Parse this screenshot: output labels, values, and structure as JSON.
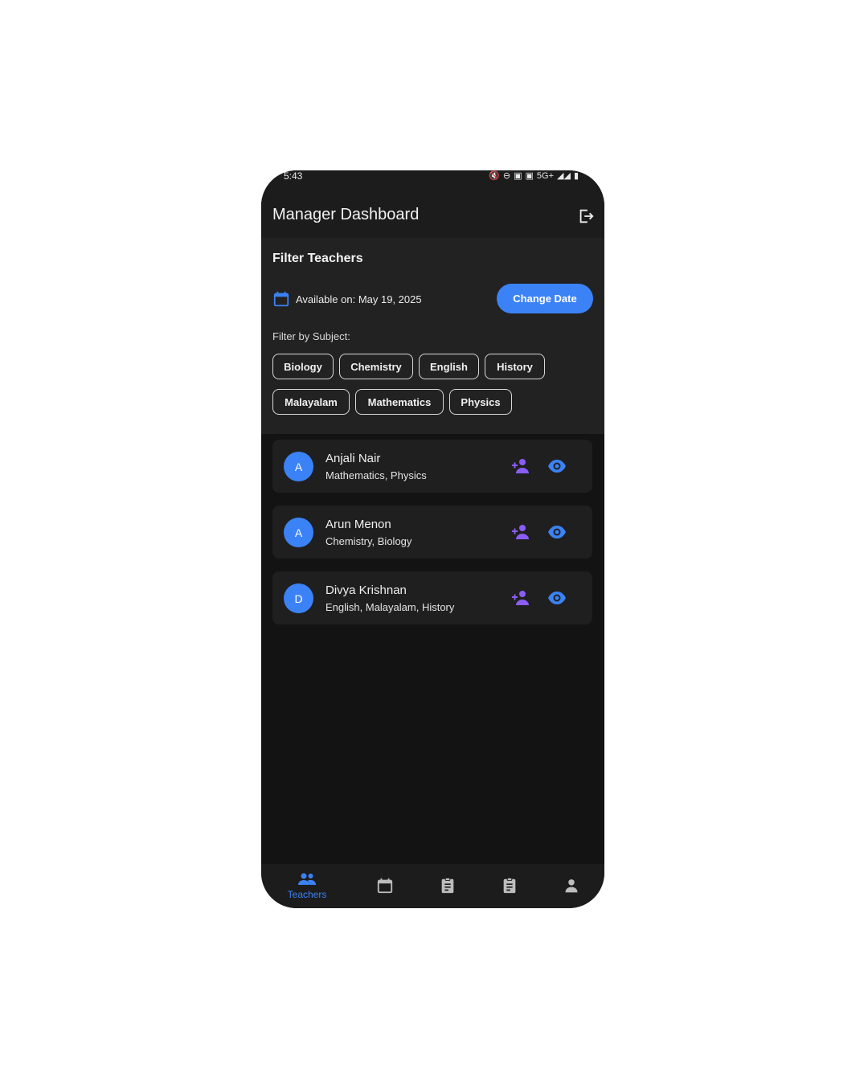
{
  "status_bar": {
    "time": "5:43",
    "network": "5G+"
  },
  "header": {
    "title": "Manager Dashboard"
  },
  "filter": {
    "heading": "Filter Teachers",
    "available_text": "Available on: May 19, 2025",
    "change_date_label": "Change Date",
    "subject_label": "Filter by Subject:",
    "subjects": [
      "Biology",
      "Chemistry",
      "English",
      "History",
      "Malayalam",
      "Mathematics",
      "Physics"
    ]
  },
  "teachers": [
    {
      "initial": "A",
      "name": "Anjali Nair",
      "subjects": "Mathematics, Physics"
    },
    {
      "initial": "A",
      "name": "Arun Menon",
      "subjects": "Chemistry, Biology"
    },
    {
      "initial": "D",
      "name": "Divya Krishnan",
      "subjects": "English, Malayalam, History"
    }
  ],
  "bottom_nav": {
    "items": [
      {
        "icon": "people-icon",
        "label": "Teachers",
        "active": true
      },
      {
        "icon": "calendar-icon",
        "label": ""
      },
      {
        "icon": "clipboard-icon",
        "label": ""
      },
      {
        "icon": "clipboard-icon",
        "label": ""
      },
      {
        "icon": "person-icon",
        "label": ""
      }
    ]
  },
  "colors": {
    "accent": "#3b82f6",
    "assign_icon": "#8b5cf6",
    "background": "#131313"
  }
}
